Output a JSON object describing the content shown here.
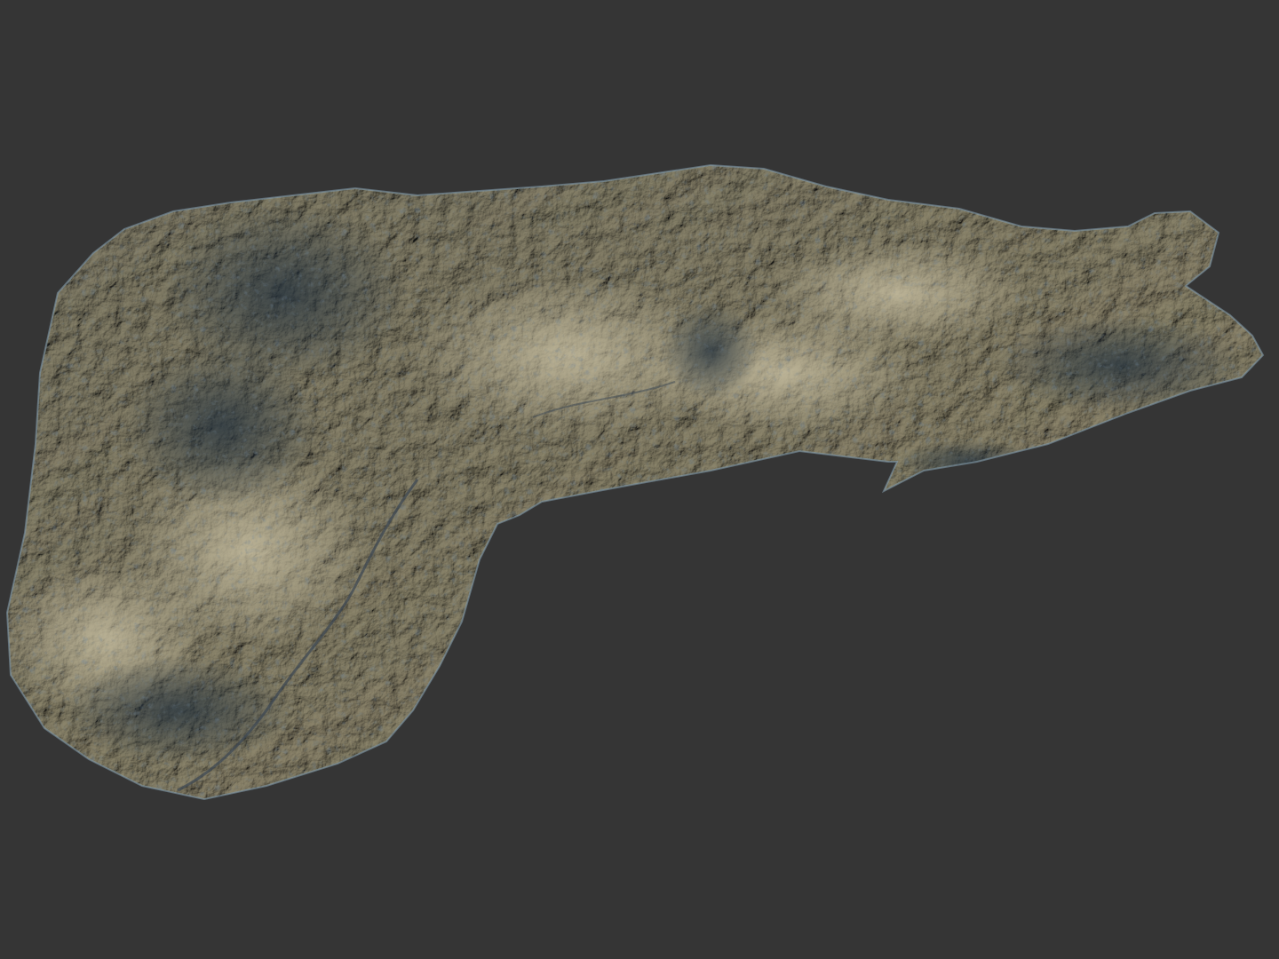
{
  "scene": {
    "subject": "terrain-mesh",
    "colors": {
      "background": "#353535",
      "rock_light": "#c9c1a6",
      "rock_mid": "#8a8c86",
      "rock_shadow": "#3c4d5c",
      "rock_blue_highlight": "#a6c3d6"
    }
  }
}
